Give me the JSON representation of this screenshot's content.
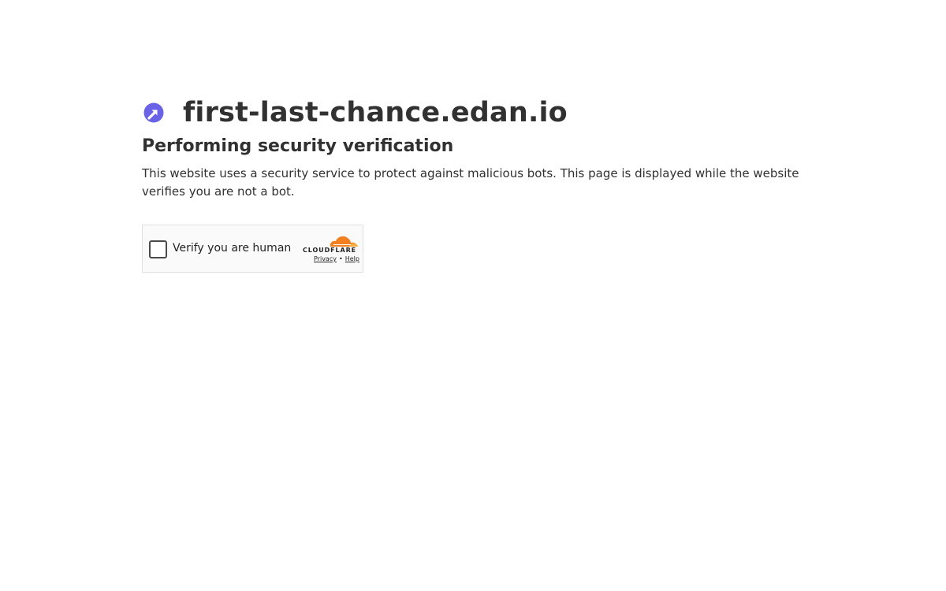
{
  "site": {
    "name": "first-last-chance.edan.io",
    "favicon_icon": "circle-arrow-icon",
    "favicon_color": "#6b63e6"
  },
  "page": {
    "subtitle": "Performing security verification",
    "description": "This website uses a security service to protect against malicious bots. This page is displayed while the website verifies you are not a bot."
  },
  "challenge": {
    "checkbox_label": "Verify you are human",
    "checked": false,
    "brand": "CLOUDFLARE",
    "brand_color": "#f38020",
    "privacy_link": "Privacy",
    "separator": "•",
    "help_link": "Help"
  }
}
